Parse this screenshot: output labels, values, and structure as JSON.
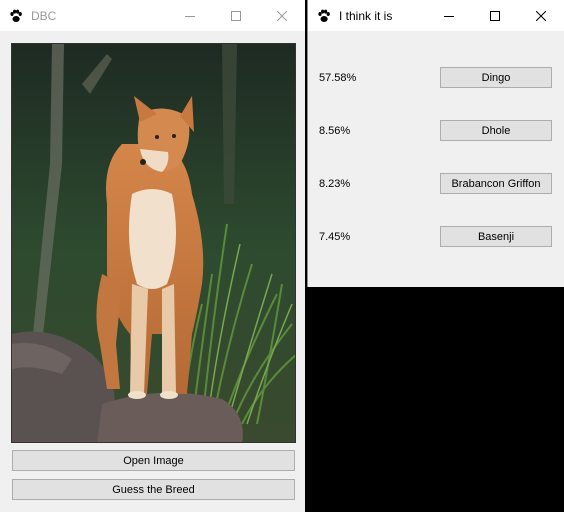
{
  "window_main": {
    "title": "DBC",
    "open_button": "Open Image",
    "guess_button": "Guess the Breed"
  },
  "window_result": {
    "title": "I think it is",
    "predictions": [
      {
        "percent": "57.58%",
        "breed": "Dingo"
      },
      {
        "percent": "8.56%",
        "breed": "Dhole"
      },
      {
        "percent": "8.23%",
        "breed": "Brabancon Griffon"
      },
      {
        "percent": "7.45%",
        "breed": "Basenji"
      }
    ]
  },
  "icons": {
    "app": "paw-icon",
    "minimize": "minimize-icon",
    "maximize": "maximize-icon",
    "close": "close-icon"
  }
}
